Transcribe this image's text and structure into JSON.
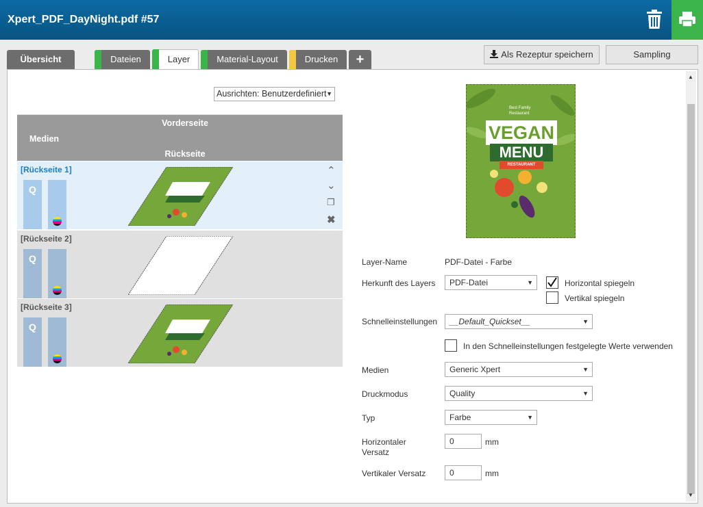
{
  "window": {
    "title": "Xpert_PDF_DayNight.pdf #57"
  },
  "tabs": [
    {
      "label": "Übersicht"
    },
    {
      "label": "Dateien",
      "accent": "#3bb54a"
    },
    {
      "label": "Layer",
      "accent": "#3bb54a"
    },
    {
      "label": "Material-Layout",
      "accent": "#3bb54a"
    },
    {
      "label": "Drucken",
      "accent": "#f2c744"
    },
    {
      "label": "+"
    }
  ],
  "toolbar": {
    "save_recipe": "Als Rezeptur speichern",
    "sampling": "Sampling"
  },
  "align_dropdown": {
    "value": "Ausrichten: Benutzerdefiniert"
  },
  "layer_table": {
    "header_front": "Vorderseite",
    "header_media": "Medien",
    "header_back": "Rückseite",
    "rows": [
      {
        "label": "[Rückseite 1]",
        "q": "Q",
        "image": "vegan-menu",
        "selected": true
      },
      {
        "label": "[Rückseite 2]",
        "q": "Q",
        "image": "blank",
        "selected": false
      },
      {
        "label": "[Rückseite 3]",
        "q": "Q",
        "image": "vegan-menu",
        "selected": false
      }
    ]
  },
  "preview": {
    "top_text": "Best Family\nRestaurant",
    "word1": "VEGAN",
    "word2": "MENU",
    "ribbon": "RESTAURANT"
  },
  "form": {
    "layer_name_label": "Layer-Name",
    "layer_name_value": "PDF-Datei - Farbe",
    "origin_label": "Herkunft des Layers",
    "origin_value": "PDF-Datei",
    "flip_h_label": "Horizontal spiegeln",
    "flip_h_checked": true,
    "flip_v_label": "Vertikal spiegeln",
    "flip_v_checked": false,
    "quick_label": "Schnelleinstellungen",
    "quick_value": "__Default_Quickset__",
    "use_quick_label": "In den Schnelleinstellungen festgelegte Werte verwenden",
    "use_quick_checked": false,
    "media_label": "Medien",
    "media_value": "Generic Xpert",
    "mode_label": "Druckmodus",
    "mode_value": "Quality",
    "type_label": "Typ",
    "type_value": "Farbe",
    "h_offset_label": "Horizontaler Versatz",
    "h_offset_value": "0",
    "h_offset_unit": "mm",
    "v_offset_label": "Vertikaler Versatz",
    "v_offset_value": "0",
    "v_offset_unit": "mm"
  }
}
